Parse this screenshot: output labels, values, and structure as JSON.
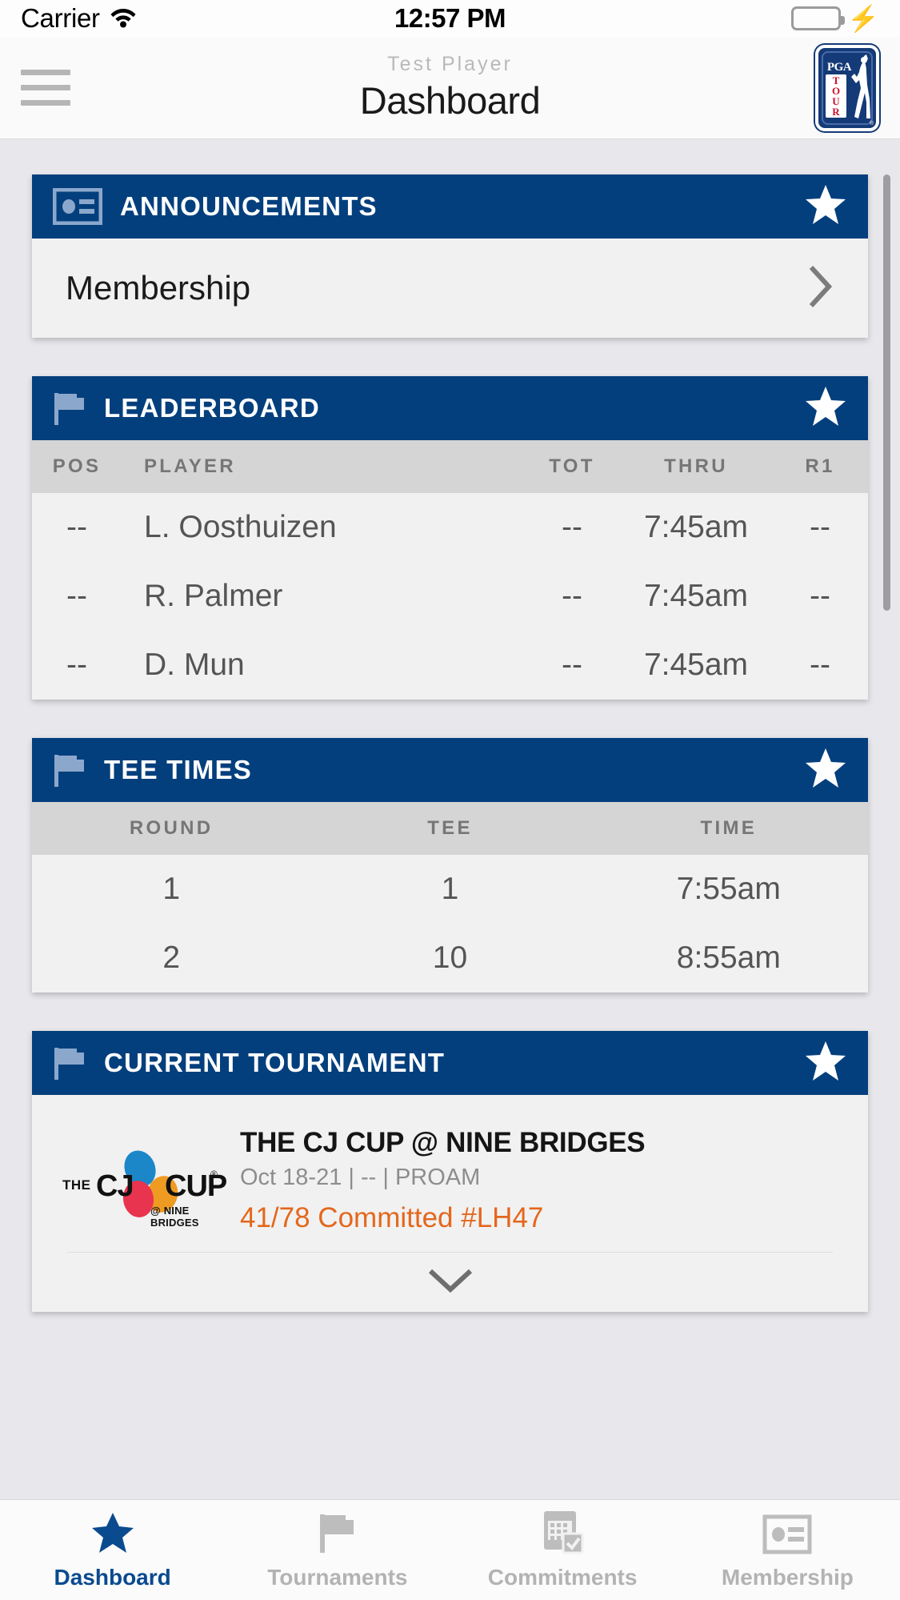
{
  "status_bar": {
    "carrier": "Carrier",
    "wifi_icon": "wifi-icon",
    "time": "12:57 PM",
    "battery_icon": "battery-full-icon",
    "charging_icon": "lightning-bolt-icon"
  },
  "header": {
    "menu_icon": "hamburger-menu-icon",
    "subtitle": "Test Player",
    "title": "Dashboard",
    "logo": {
      "name": "pga-tour-logo",
      "pga": "PGA",
      "tour_letters": [
        "T",
        "O",
        "U",
        "R"
      ],
      "registered": "®"
    }
  },
  "cards": [
    {
      "id": "announcements",
      "icon": "id-card-icon",
      "title": "ANNOUNCEMENTS",
      "star_icon": "star-filled-icon",
      "rows": [
        {
          "label": "Membership",
          "chevron_icon": "chevron-right-icon"
        }
      ]
    },
    {
      "id": "leaderboard",
      "icon": "golf-flag-icon",
      "title": "LEADERBOARD",
      "star_icon": "star-filled-icon",
      "columns": [
        "POS",
        "PLAYER",
        "TOT",
        "THRU",
        "R1"
      ],
      "rows": [
        {
          "pos": "--",
          "player": "L. Oosthuizen",
          "tot": "--",
          "thru": "7:45am",
          "r1": "--"
        },
        {
          "pos": "--",
          "player": "R. Palmer",
          "tot": "--",
          "thru": "7:45am",
          "r1": "--"
        },
        {
          "pos": "--",
          "player": "D. Mun",
          "tot": "--",
          "thru": "7:45am",
          "r1": "--"
        }
      ]
    },
    {
      "id": "tee-times",
      "icon": "golf-flag-icon",
      "title": "TEE TIMES",
      "star_icon": "star-filled-icon",
      "columns": [
        "ROUND",
        "TEE",
        "TIME"
      ],
      "rows": [
        {
          "round": "1",
          "tee": "1",
          "time": "7:55am"
        },
        {
          "round": "2",
          "tee": "10",
          "time": "8:55am"
        }
      ]
    },
    {
      "id": "current-tournament",
      "icon": "golf-flag-icon",
      "title": "CURRENT TOURNAMENT",
      "star_icon": "star-filled-icon",
      "tournament": {
        "logo": {
          "name": "cj-cup-logo",
          "the": "THE",
          "cj": "CJ",
          "cup": "CUP",
          "registered": "®",
          "venue": "@ NINE BRIDGES"
        },
        "name": "THE CJ CUP @ NINE BRIDGES",
        "meta": "Oct 18-21 | -- | PROAM",
        "commitment": "41/78  Committed #LH47",
        "expand_icon": "chevron-down-icon"
      }
    }
  ],
  "tabbar": [
    {
      "id": "dashboard",
      "label": "Dashboard",
      "icon": "star-filled-icon",
      "active": true
    },
    {
      "id": "tournaments",
      "label": "Tournaments",
      "icon": "golf-flag-icon",
      "active": false
    },
    {
      "id": "commitments",
      "label": "Commitments",
      "icon": "calendar-check-icon",
      "active": false
    },
    {
      "id": "membership",
      "label": "Membership",
      "icon": "id-card-icon",
      "active": false
    }
  ],
  "colors": {
    "brand_blue": "#043f7d",
    "accent_orange": "#e4671c",
    "page_bg": "#e8e8ec",
    "card_bg": "#f1f1f1",
    "table_header_bg": "#d5d5d5",
    "active_tab": "#0a4a8f",
    "battery_green": "#4cd662"
  }
}
